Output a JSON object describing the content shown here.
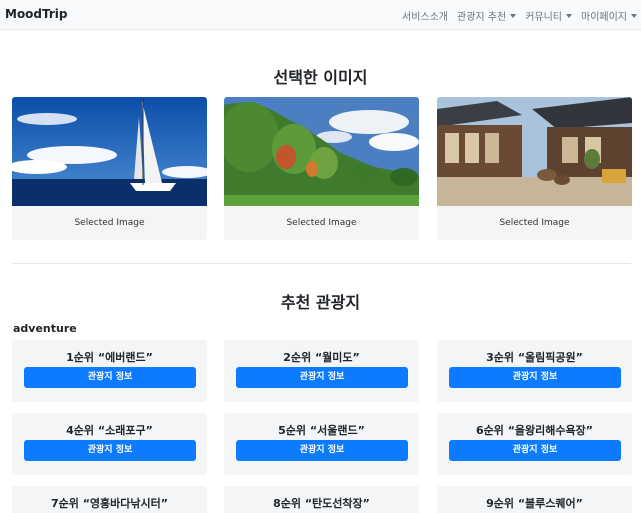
{
  "navbar": {
    "brand": "MoodTrip",
    "links": [
      {
        "label": "서비스소개",
        "dropdown": false
      },
      {
        "label": "관광지 추천",
        "dropdown": true
      },
      {
        "label": "커뮤니티",
        "dropdown": true
      },
      {
        "label": "마이페이지",
        "dropdown": true
      }
    ]
  },
  "selected_section": {
    "title": "선택한 이미지",
    "images": [
      {
        "caption": "Selected Image",
        "icon": "sailboat-photo"
      },
      {
        "caption": "Selected Image",
        "icon": "forest-photo"
      },
      {
        "caption": "Selected Image",
        "icon": "hanok-photo"
      }
    ]
  },
  "recommend_section": {
    "title": "추천 관광지",
    "category": "adventure",
    "button_label": "관광지 정보",
    "places": [
      "1순위 “에버랜드”",
      "2순위 “월미도”",
      "3순위 “올림픽공원”",
      "4순위 “소래포구”",
      "5순위 “서울랜드”",
      "6순위 “을왕리해수욕장”",
      "7순위 “영흥바다낚시터”",
      "8순위 “탄도선착장”",
      "9순위 “블루스퀘어”"
    ]
  },
  "colors": {
    "primary_button": "#0d7bff",
    "card_bg": "#f4f5f7",
    "navbar_bg": "#f8f9fa"
  }
}
